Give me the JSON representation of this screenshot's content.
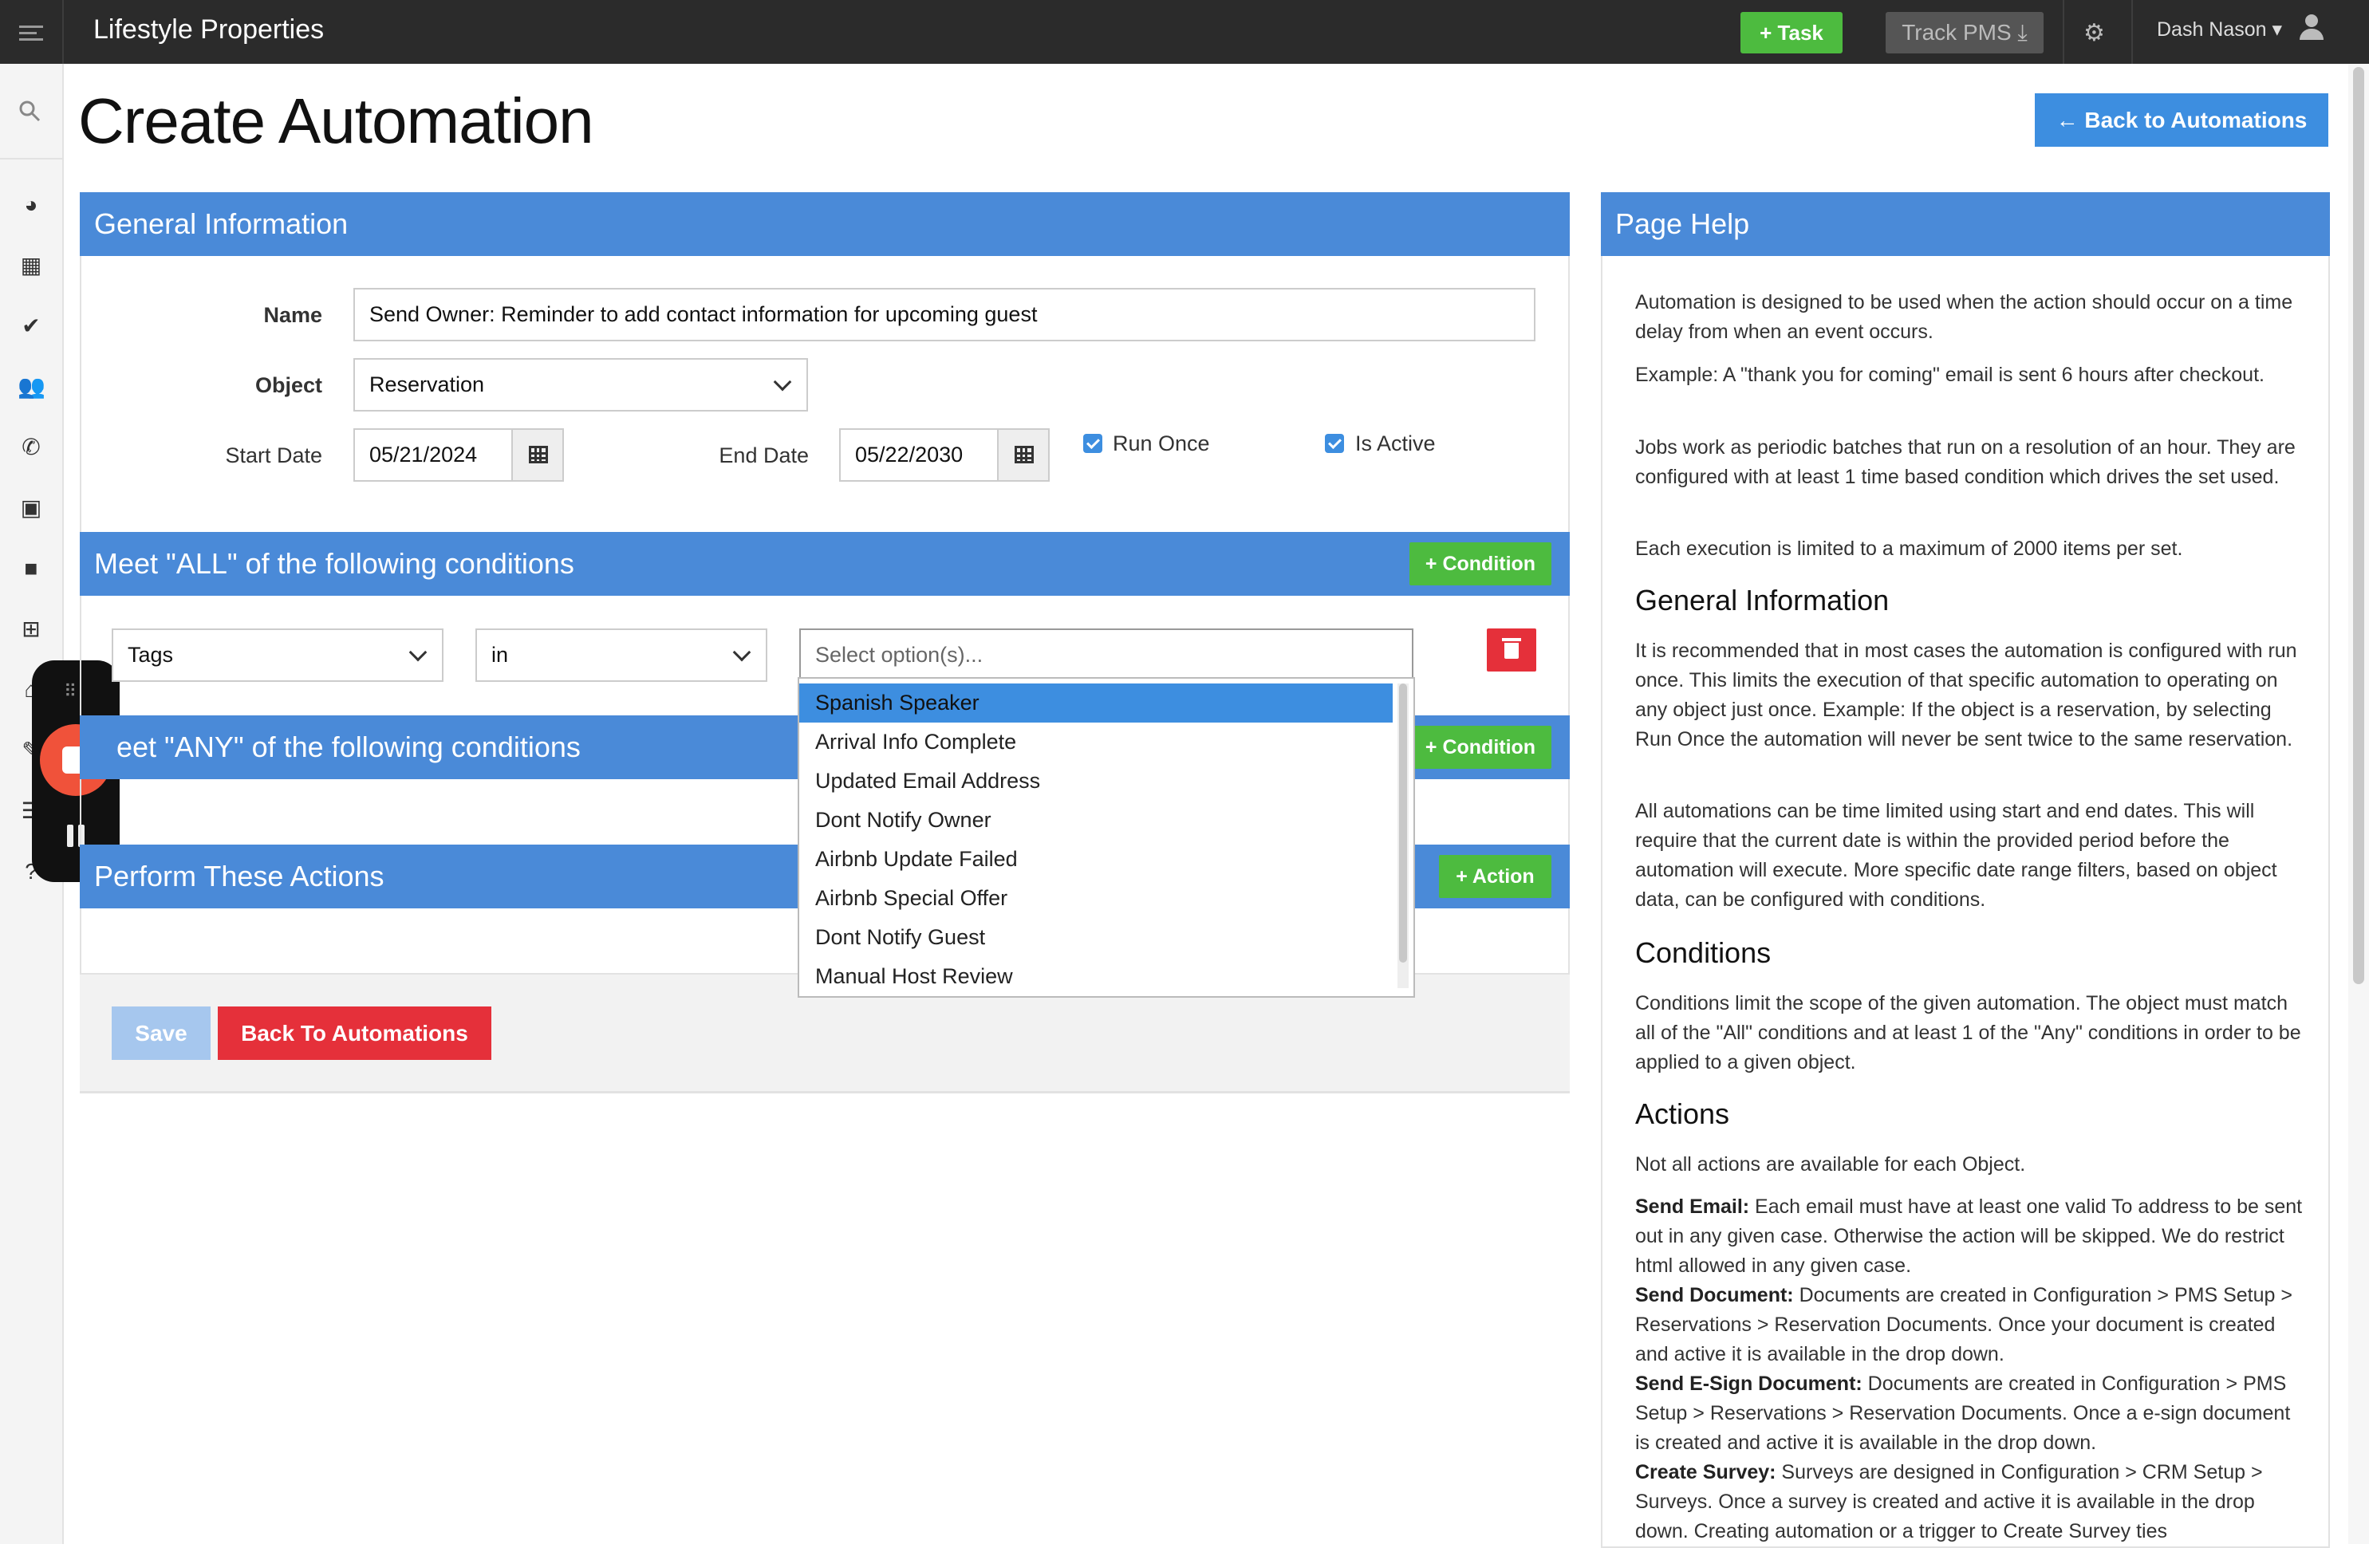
{
  "app": {
    "title": "Lifestyle Properties"
  },
  "topbar": {
    "task_label": "+ Task",
    "track_label": "Track PMS ⤓",
    "user_name": "Dash Nason ▾"
  },
  "page": {
    "title": "Create Automation",
    "back_button": "← Back to Automations"
  },
  "general": {
    "header": "General Information",
    "name_label": "Name",
    "name_value": "Send Owner: Reminder to add contact information for upcoming guest",
    "object_label": "Object",
    "object_value": "Reservation",
    "start_label": "Start Date",
    "start_value": "05/21/2024",
    "end_label": "End Date",
    "end_value": "05/22/2030",
    "run_once_label": "Run Once",
    "is_active_label": "Is Active"
  },
  "all_conditions": {
    "header": "Meet \"ALL\" of the following conditions",
    "button": "+ Condition",
    "field_value": "Tags",
    "operator_value": "in",
    "options_placeholder": "Select option(s)..."
  },
  "any_conditions": {
    "header": "eet \"ANY\" of the following conditions",
    "button": "+ Condition"
  },
  "actions": {
    "header": "Perform These Actions",
    "button": "+ Action"
  },
  "dropdown": {
    "options": [
      "Spanish Speaker",
      "Arrival Info Complete",
      "Updated Email Address",
      "Dont Notify Owner",
      "Airbnb Update Failed",
      "Airbnb Special Offer",
      "Dont Notify Guest",
      "Manual Host Review"
    ],
    "selected": "Spanish Speaker"
  },
  "footer": {
    "save": "Save",
    "back": "Back To Automations"
  },
  "help": {
    "header": "Page Help",
    "p1": "Automation is designed to be used when the action should occur on a time delay from when an event occurs.",
    "p2": "Example: A \"thank you for coming\" email is sent 6 hours after checkout.",
    "p3": "Jobs work as periodic batches that run on a resolution of an hour. They are configured with at least 1 time based condition which drives the set used.",
    "p4": "Each execution is limited to a maximum of 2000 items per set.",
    "h_general": "General Information",
    "p5": "It is recommended that in most cases the automation is configured with run once. This limits the execution of that specific automation to operating on any object just once. Example: If the object is a reservation, by selecting Run Once the automation will never be sent twice to the same reservation.",
    "p6": "All automations can be time limited using start and end dates. This will require that the current date is within the provided period before the automation will execute. More specific date range filters, based on object data, can be configured with conditions.",
    "h_conditions": "Conditions",
    "p7": "Conditions limit the scope of the given automation. The object must match all of the \"All\" conditions and at least 1 of the \"Any\" conditions in order to be applied to a given object.",
    "h_actions": "Actions",
    "p8": "Not all actions are available for each Object.",
    "send_email_b": "Send Email:",
    "send_email": " Each email must have at least one valid To address to be sent out in any given case. Otherwise the action will be skipped. We do restrict html allowed in any given case.",
    "send_doc_b": "Send Document:",
    "send_doc": " Documents are created in Configuration > PMS Setup > Reservations > Reservation Documents. Once your document is created and active it is available in the drop down.",
    "send_esign_b": "Send E-Sign Document:",
    "send_esign": " Documents are created in Configuration > PMS Setup > Reservations > Reservation Documents. Once a e-sign document is created and active it is available in the drop down.",
    "survey_b": "Create Survey:",
    "survey": " Surveys are designed in Configuration > CRM Setup > Surveys. Once a survey is created and active it is available in the drop down. Creating automation or a trigger to Create Survey ties"
  }
}
